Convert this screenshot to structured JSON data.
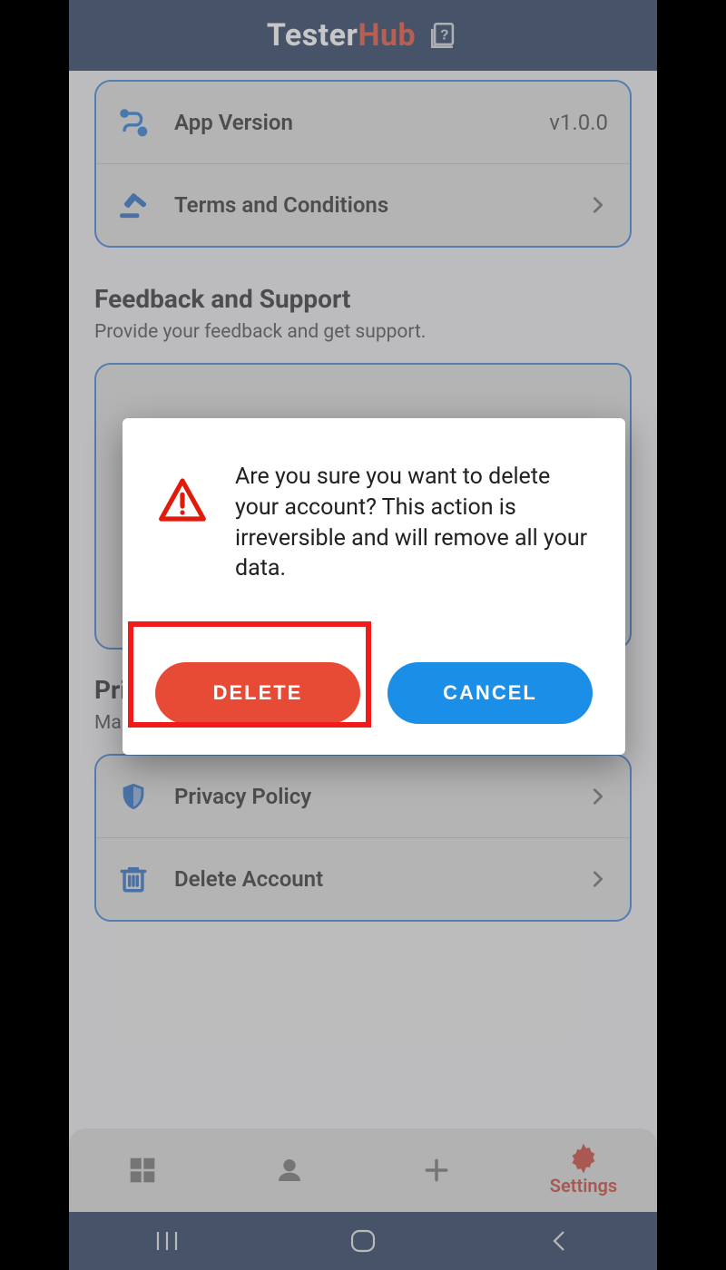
{
  "header": {
    "title_a": "Tester",
    "title_b": "Hub"
  },
  "about_card": {
    "version_label": "App Version",
    "version_value": "v1.0.0",
    "terms_label": "Terms and Conditions"
  },
  "feedback": {
    "title": "Feedback and Support",
    "subtitle": "Provide your feedback and get support."
  },
  "privacy": {
    "title": "Privacy and Security",
    "subtitle": "Manage your privacy settings and account security.",
    "policy_label": "Privacy Policy",
    "delete_label": "Delete Account"
  },
  "tabs": {
    "settings_label": "Settings"
  },
  "dialog": {
    "message": "Are you sure you want to delete your account? This action is irreversible and will remove all your data.",
    "delete_label": "DELETE",
    "cancel_label": "CANCEL"
  },
  "colors": {
    "header_bg": "#172d53",
    "brand_accent": "#e4432a",
    "card_border": "#2f78d6",
    "delete_btn": "#e84b35",
    "cancel_btn": "#1b8fe8",
    "highlight_box": "#f21b1b",
    "active_tab": "#c5372b"
  }
}
